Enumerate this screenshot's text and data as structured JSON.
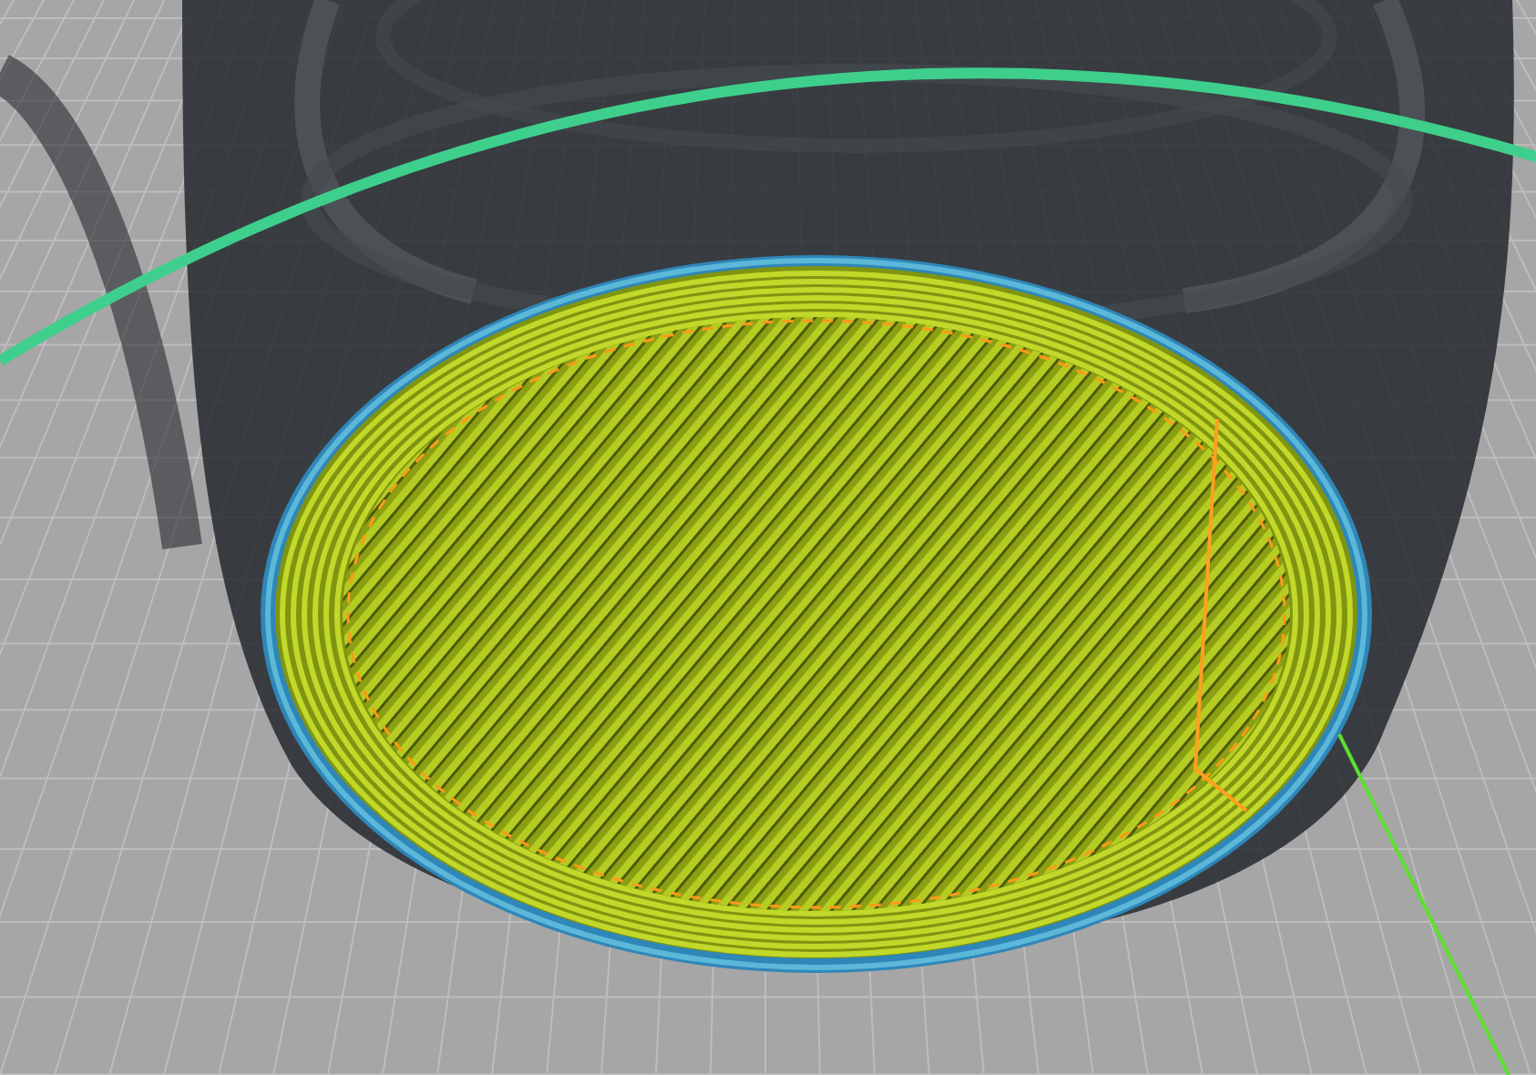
{
  "view": {
    "kind": "layer-preview"
  }
}
